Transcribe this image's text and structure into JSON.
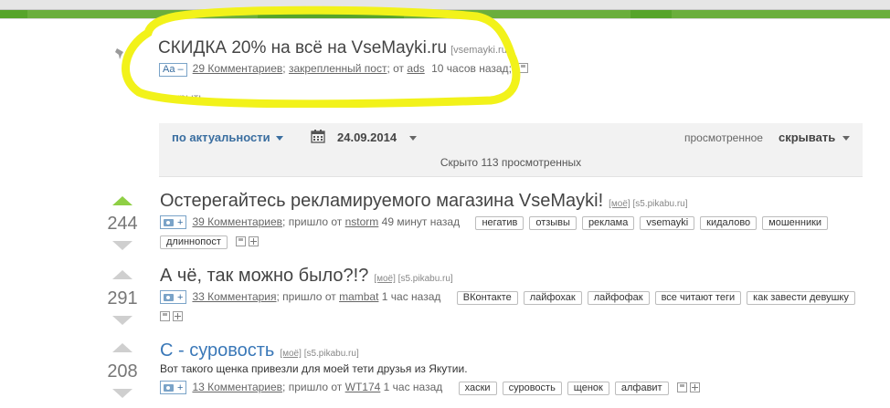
{
  "colors": {
    "accent_green": "#6aae3c",
    "link_blue": "#3a6ea0",
    "highlight_yellow": "#f2f21a",
    "upvote_green": "#8fcf45"
  },
  "sticky": {
    "title": "СКИДКА 20% на всё на VseMayki.ru",
    "domain": "[vsemayki.ru]",
    "aa_label": "Aa –",
    "comments": "29 Комментариев",
    "sep1": ";",
    "pinned": "закрепленный пост",
    "from_prefix": "; от",
    "author": "ads",
    "time": "10 часов назад",
    "sep2": ";",
    "close": "закрыть"
  },
  "filter": {
    "sort": "по актуальности",
    "date": "24.09.2014",
    "viewed": "просмотренное",
    "hide": "скрывать",
    "hidden_count": "Скрыто 113 просмотренных"
  },
  "posts": [
    {
      "rating": "244",
      "title": "Остерегайтесь рекламируемого магазина VseMayki!",
      "mine": "[моё]",
      "source": "[s5.pikabu.ru]",
      "comments": "39 Комментариев",
      "from_prefix": "; пришло от",
      "author": "nstorm",
      "time": "49 минут назад",
      "tags": [
        "негатив",
        "отзывы",
        "реклама",
        "vsemayki",
        "кидалово",
        "мошенники",
        "длиннопост"
      ]
    },
    {
      "rating": "291",
      "title": "А чё, так можно было?!?",
      "mine": "[моё]",
      "source": "[s5.pikabu.ru]",
      "comments": "33 Комментария",
      "from_prefix": "; пришло от",
      "author": "mambat",
      "time": "1 час назад",
      "tags": [
        "ВКонтакте",
        "лайфохак",
        "лайфофак",
        "все читают теги",
        "как завести девушку"
      ]
    },
    {
      "rating": "208",
      "title": "С - суровость",
      "mine": "[моё]",
      "source": "[s5.pikabu.ru]",
      "excerpt": "Вот такого щенка привезли для моей тети друзья из Якутии.",
      "comments": "13 Комментариев",
      "from_prefix": "; пришло от",
      "author": "WT174",
      "time": "1 час назад",
      "tags": [
        "хаски",
        "суровость",
        "щенок",
        "алфавит"
      ]
    }
  ],
  "icons": [
    "pin-icon",
    "calendar-icon",
    "camera-icon",
    "save-icon",
    "expand-icon",
    "upvote-icon",
    "downvote-icon"
  ]
}
